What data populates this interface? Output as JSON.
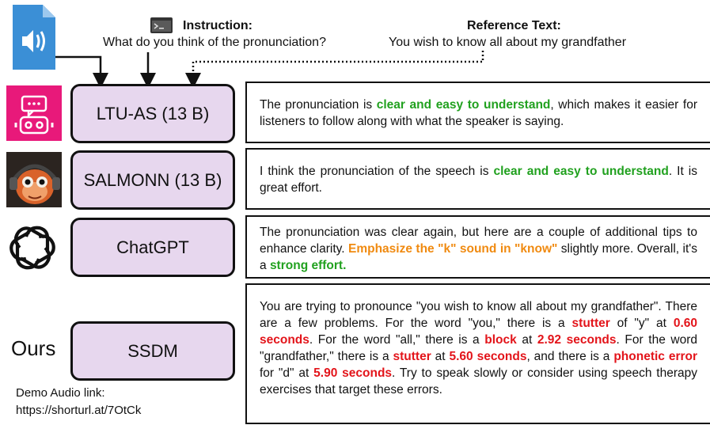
{
  "header": {
    "instruction_title": "Instruction:",
    "instruction_text": "What do you think of the pronunciation?",
    "reference_title": "Reference Text:",
    "reference_text": "You wish to know all about my grandfather"
  },
  "models": [
    {
      "name": "LTU-AS (13 B)",
      "icon": "robot-chat-icon",
      "response": [
        {
          "t": "The pronunciation is "
        },
        {
          "t": "clear and easy to understand",
          "c": "g"
        },
        {
          "t": ", which makes it easier for listeners to follow along with what the speaker is saying."
        }
      ]
    },
    {
      "name": "SALMONN (13 B)",
      "icon": "salmon-avatar-icon",
      "response": [
        {
          "t": "I think the pronunciation of the speech is "
        },
        {
          "t": "clear and easy to understand",
          "c": "g"
        },
        {
          "t": ". It is great effort."
        }
      ]
    },
    {
      "name": "ChatGPT",
      "icon": "openai-logo-icon",
      "response": [
        {
          "t": "The pronunciation was clear again, but here are a couple of additional tips to enhance clarity. "
        },
        {
          "t": "Emphasize the \"k\" sound in \"know\"",
          "c": "o"
        },
        {
          "t": " slightly more. Overall, it's a "
        },
        {
          "t": "strong effort.",
          "c": "g"
        }
      ]
    },
    {
      "name": "SSDM",
      "icon": "",
      "response": [
        {
          "t": "You are trying to pronounce \"you wish to know all about my grandfather\". There are a few problems. For the word \"you,\" there is a "
        },
        {
          "t": "stutter",
          "c": "r"
        },
        {
          "t": " of \"y\" at "
        },
        {
          "t": "0.60 seconds",
          "c": "r"
        },
        {
          "t": ".  For the word \"all,\" there is a "
        },
        {
          "t": "block",
          "c": "r"
        },
        {
          "t": " at "
        },
        {
          "t": "2.92 seconds",
          "c": "r"
        },
        {
          "t": ". For the word \"grandfather,\" there is a "
        },
        {
          "t": "stutter",
          "c": "r"
        },
        {
          "t": " at "
        },
        {
          "t": "5.60 seconds",
          "c": "r"
        },
        {
          "t": ", and there is a "
        },
        {
          "t": "phonetic error",
          "c": "r"
        },
        {
          "t": " for \"d\" at "
        },
        {
          "t": "5.90 seconds",
          "c": "r"
        },
        {
          "t": ". Try to speak slowly or consider using speech therapy exercises that target these errors."
        }
      ]
    }
  ],
  "ours_label": "Ours",
  "demo_label": "Demo Audio link:",
  "demo_link": "https://shorturl.at/7OtCk",
  "colors": {
    "model_fill": "#e7d7ee",
    "highlight_green": "#21a11f",
    "highlight_orange": "#f08a10",
    "highlight_red": "#e3141a",
    "audio_file_blue": "#3b8fd6",
    "robot_pink": "#e8197a"
  }
}
